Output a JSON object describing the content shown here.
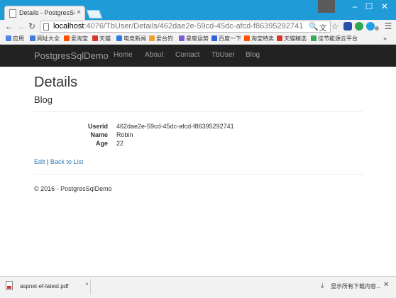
{
  "browser": {
    "tab_title": "Details - PostgresSqlDe",
    "tab_close": "×",
    "window_controls": {
      "minimize": "–",
      "maximize": "☐",
      "close": "✕"
    },
    "url_host": "localhost",
    "url_path": ":4076/TbUser/Details/462dae2e-59cd-45dc-afcd-f86395292741",
    "nav": {
      "back": "←",
      "forward": "→",
      "reload": "↻"
    },
    "omnibox_icons": {
      "zoom": "🔍",
      "translate": "文",
      "star": "☆"
    },
    "menu": "☰"
  },
  "bookmarks": {
    "apps_label": "应用",
    "items": [
      {
        "label": "网址大全",
        "color": "#3b7dd8"
      },
      {
        "label": "爱淘宝",
        "color": "#ff5000"
      },
      {
        "label": "天猫",
        "color": "#d9362b"
      },
      {
        "label": "电竞新闻",
        "color": "#2c7be5"
      },
      {
        "label": "爱台钓",
        "color": "#f0a030"
      },
      {
        "label": "星座运势",
        "color": "#7d5bd6"
      },
      {
        "label": "百度一下",
        "color": "#2f63d8"
      },
      {
        "label": "淘宝特卖",
        "color": "#ff5000"
      },
      {
        "label": "天猫精选",
        "color": "#d9362b"
      },
      {
        "label": "佳节能源云平台",
        "color": "#3aa657"
      }
    ],
    "more": "»"
  },
  "site": {
    "brand": "PostgresSqlDemo",
    "nav": [
      "Home",
      "About",
      "Contact",
      "TbUser",
      "Blog"
    ]
  },
  "content": {
    "heading": "Details",
    "subheading": "Blog",
    "fields": [
      {
        "label": "Userid",
        "value": "462dae2e-59cd-45dc-afcd-f86395292741"
      },
      {
        "label": "Name",
        "value": "Robin"
      },
      {
        "label": "Age",
        "value": "22"
      }
    ],
    "edit_link": "Edit",
    "separator": " | ",
    "back_link": "Back to List",
    "footer": "© 2016 - PostgresSqlDemo"
  },
  "downloads": {
    "file_name": "aspnet-ef-latest.pdf",
    "caret": "˄",
    "show_all": "显示所有下载内容...",
    "close": "✕"
  },
  "colors": {
    "titlebar": "#1f9bd7",
    "navbar": "#222222",
    "link": "#337ab7"
  }
}
